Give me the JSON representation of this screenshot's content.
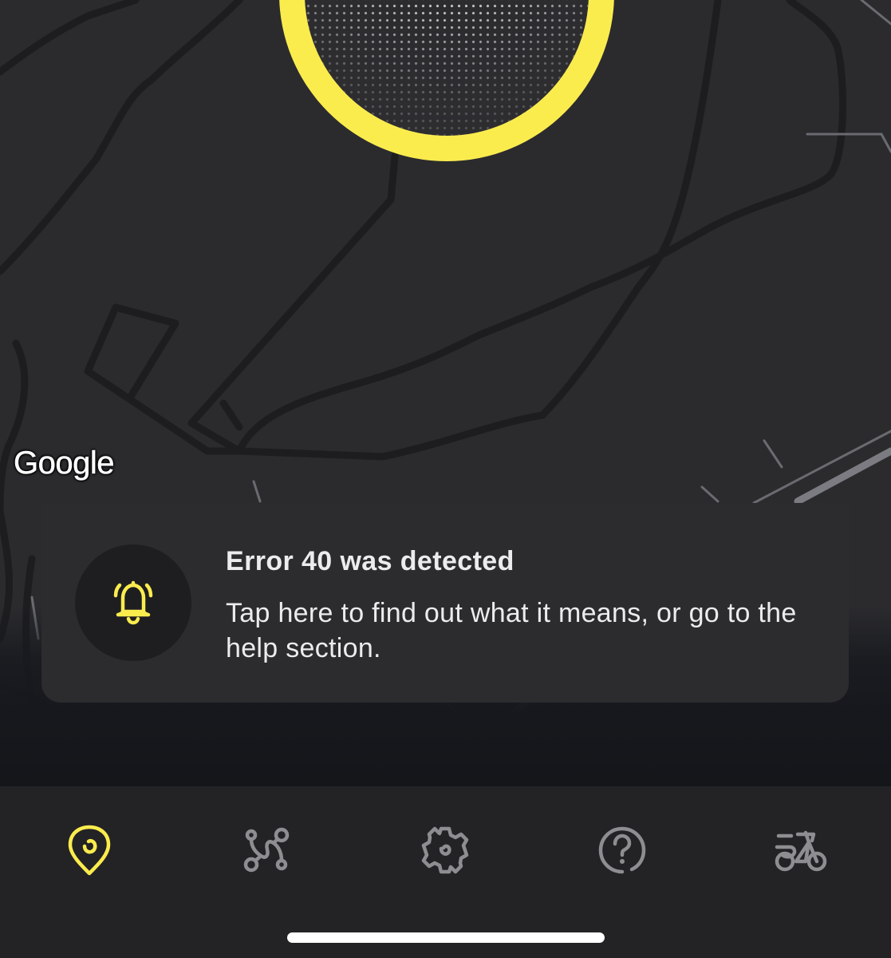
{
  "map": {
    "attribution": "Google"
  },
  "notification": {
    "title": "Error 40 was detected",
    "message": "Tap here to find out what it means, or go to the help section.",
    "icon": "alarm-bell-icon"
  },
  "tab_bar": {
    "tabs": [
      {
        "icon": "map-pin-icon",
        "active": true
      },
      {
        "icon": "route-icon",
        "active": false
      },
      {
        "icon": "gear-icon",
        "active": false
      },
      {
        "icon": "help-icon",
        "active": false
      },
      {
        "icon": "bicycle-icon",
        "active": false
      }
    ]
  },
  "colors": {
    "accent": "#fbec4e",
    "inactive_icon": "#8e8e92",
    "card_bg": "#2c2c2f",
    "tab_bar_bg": "#232325",
    "map_bg": "#2b2b2e"
  }
}
